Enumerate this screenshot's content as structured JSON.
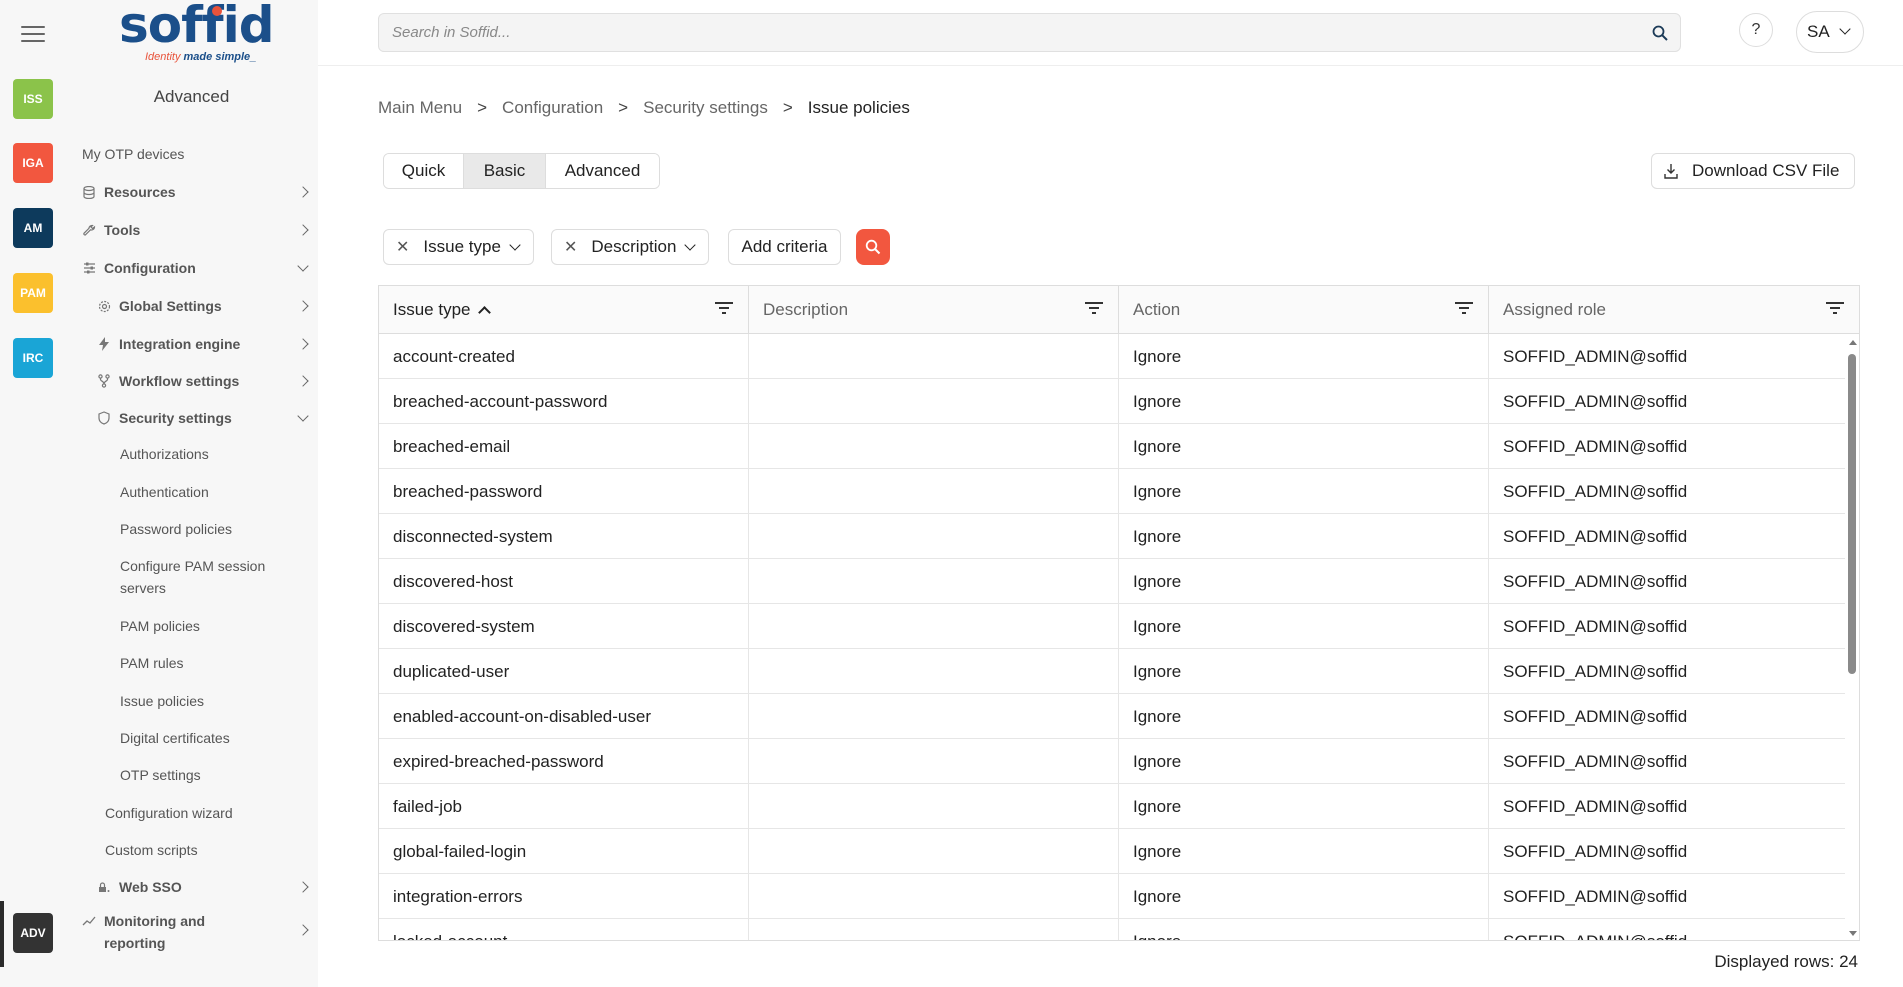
{
  "rail": {
    "apps": [
      {
        "label": "ISS",
        "color": "#8bc34a"
      },
      {
        "label": "IGA",
        "color": "#f2573f"
      },
      {
        "label": "AM",
        "color": "#0d3a5c"
      },
      {
        "label": "PAM",
        "color": "#fbc02d"
      },
      {
        "label": "IRC",
        "color": "#1aa5d6"
      },
      {
        "label": "ADV",
        "color": "#333333"
      }
    ]
  },
  "logo": {
    "text": "soffid",
    "tagline_a": "Identity ",
    "tagline_b": "made simple_"
  },
  "sidebar": {
    "title": "Advanced",
    "items": [
      {
        "label": "My OTP devices"
      },
      {
        "label": "Resources"
      },
      {
        "label": "Tools"
      },
      {
        "label": "Configuration"
      },
      {
        "label": "Global Settings"
      },
      {
        "label": "Integration engine"
      },
      {
        "label": "Workflow settings"
      },
      {
        "label": "Security settings"
      },
      {
        "label": "Authorizations"
      },
      {
        "label": "Authentication"
      },
      {
        "label": "Password policies"
      },
      {
        "label": "Configure PAM session servers"
      },
      {
        "label": "PAM policies"
      },
      {
        "label": "PAM rules"
      },
      {
        "label": "Issue policies"
      },
      {
        "label": "Digital certificates"
      },
      {
        "label": "OTP settings"
      },
      {
        "label": "Configuration wizard"
      },
      {
        "label": "Custom scripts"
      },
      {
        "label": "Web SSO"
      },
      {
        "label": "Monitoring and reporting"
      }
    ]
  },
  "header": {
    "search_placeholder": "Search in Soffid...",
    "help_label": "?",
    "user_initials": "SA"
  },
  "breadcrumb": [
    "Main Menu",
    "Configuration",
    "Security settings",
    "Issue policies"
  ],
  "breadcrumb_sep": ">",
  "views": [
    "Quick",
    "Basic",
    "Advanced"
  ],
  "active_view": "Basic",
  "download_csv_label": "Download CSV File",
  "criteria": [
    "Issue type",
    "Description"
  ],
  "add_criteria_label": "Add criteria",
  "table": {
    "columns": [
      "Issue type",
      "Description",
      "Action",
      "Assigned role"
    ],
    "rows": [
      {
        "type": "account-created",
        "description": "",
        "action": "Ignore",
        "role": "SOFFID_ADMIN@soffid"
      },
      {
        "type": "breached-account-password",
        "description": "",
        "action": "Ignore",
        "role": "SOFFID_ADMIN@soffid"
      },
      {
        "type": "breached-email",
        "description": "",
        "action": "Ignore",
        "role": "SOFFID_ADMIN@soffid"
      },
      {
        "type": "breached-password",
        "description": "",
        "action": "Ignore",
        "role": "SOFFID_ADMIN@soffid"
      },
      {
        "type": "disconnected-system",
        "description": "",
        "action": "Ignore",
        "role": "SOFFID_ADMIN@soffid"
      },
      {
        "type": "discovered-host",
        "description": "",
        "action": "Ignore",
        "role": "SOFFID_ADMIN@soffid"
      },
      {
        "type": "discovered-system",
        "description": "",
        "action": "Ignore",
        "role": "SOFFID_ADMIN@soffid"
      },
      {
        "type": "duplicated-user",
        "description": "",
        "action": "Ignore",
        "role": "SOFFID_ADMIN@soffid"
      },
      {
        "type": "enabled-account-on-disabled-user",
        "description": "",
        "action": "Ignore",
        "role": "SOFFID_ADMIN@soffid"
      },
      {
        "type": "expired-breached-password",
        "description": "",
        "action": "Ignore",
        "role": "SOFFID_ADMIN@soffid"
      },
      {
        "type": "failed-job",
        "description": "",
        "action": "Ignore",
        "role": "SOFFID_ADMIN@soffid"
      },
      {
        "type": "global-failed-login",
        "description": "",
        "action": "Ignore",
        "role": "SOFFID_ADMIN@soffid"
      },
      {
        "type": "integration-errors",
        "description": "",
        "action": "Ignore",
        "role": "SOFFID_ADMIN@soffid"
      },
      {
        "type": "locked-account",
        "description": "",
        "action": "Ignore",
        "role": "SOFFID_ADMIN@soffid"
      }
    ]
  },
  "displayed_rows": "Displayed rows: 24",
  "colors": {
    "accent": "#f2573f",
    "brand": "#1b4f8a"
  }
}
